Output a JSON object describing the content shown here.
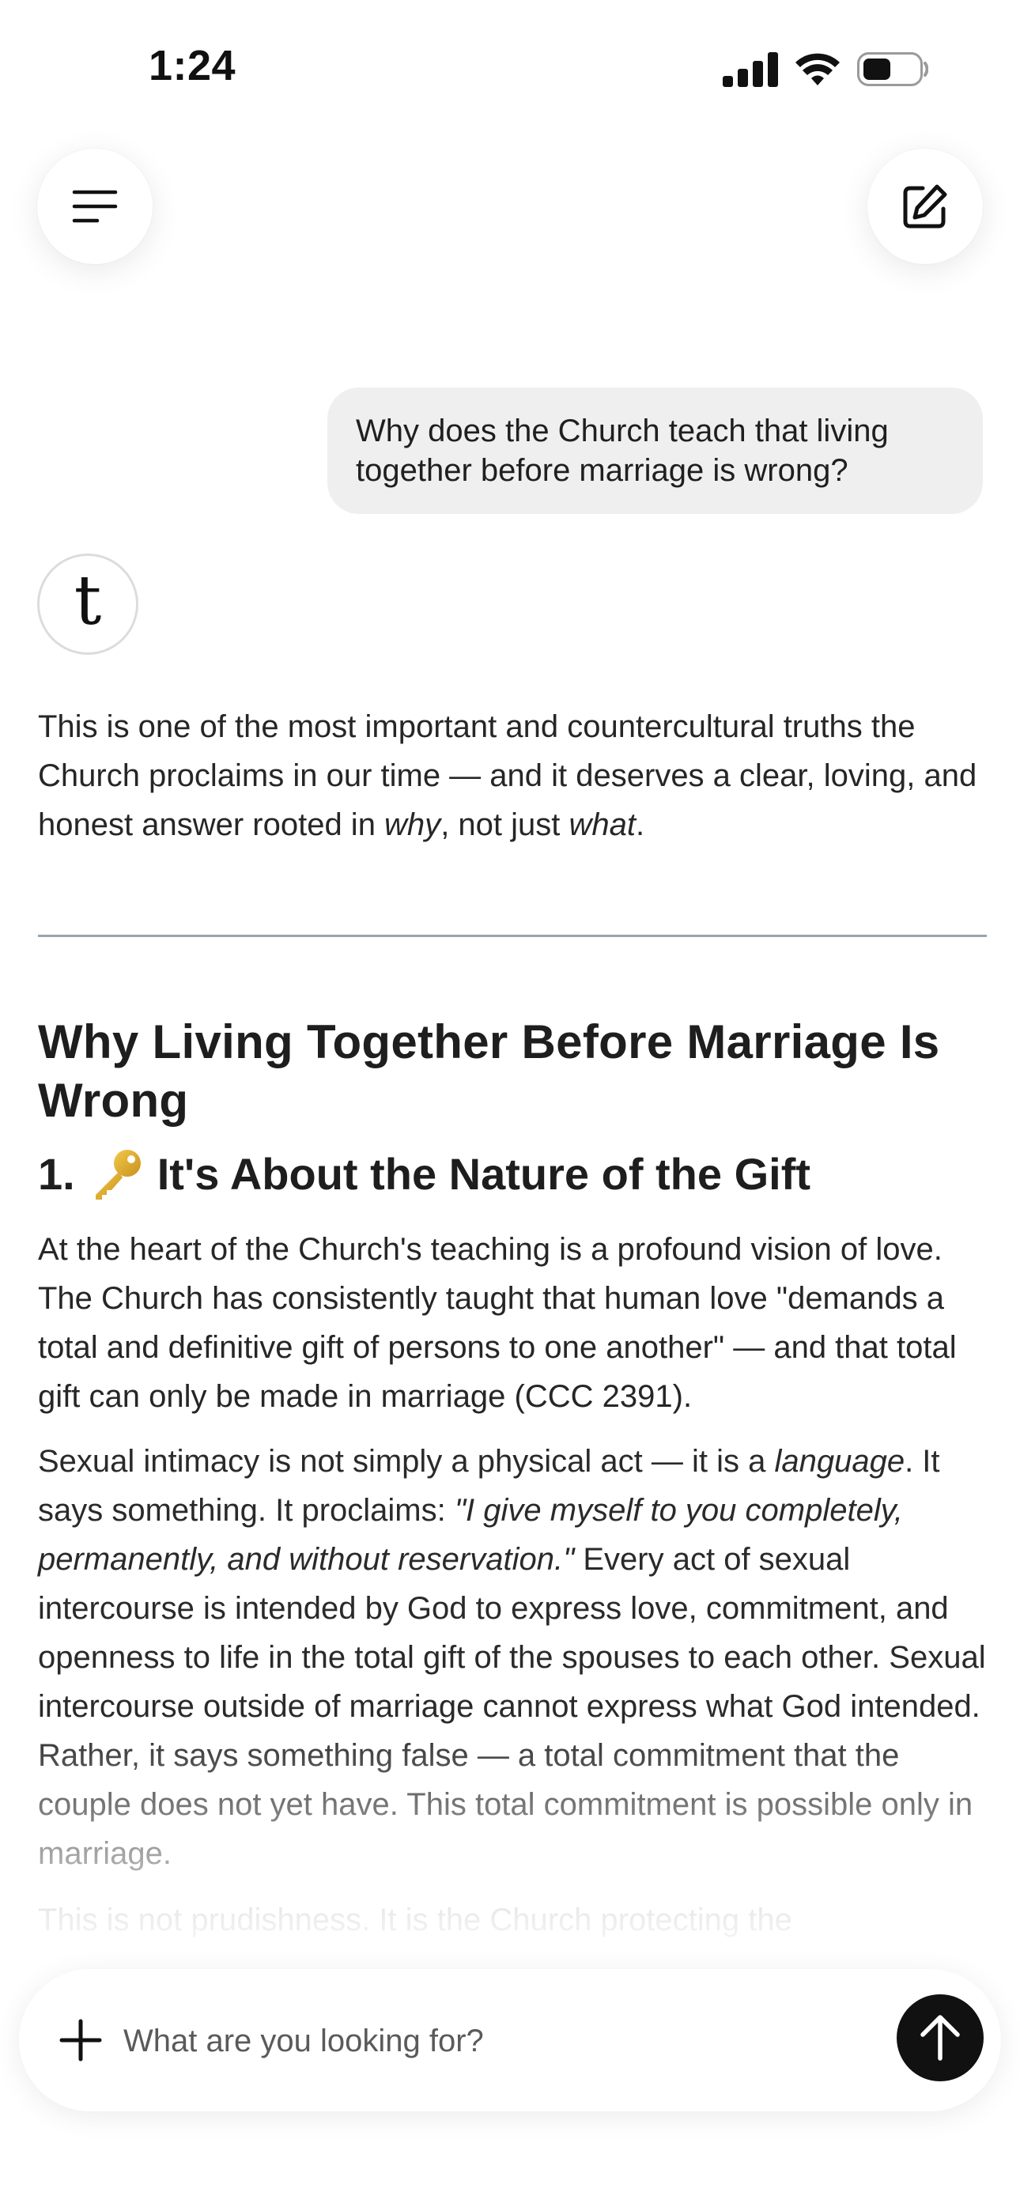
{
  "status_bar": {
    "time": "1:24"
  },
  "header": {
    "menu_icon": "hamburger-menu-icon",
    "new_chat_icon": "edit-compose-icon"
  },
  "conversation": {
    "user_message": "Why does the Church teach that living together before marriage is wrong?",
    "assistant_avatar_letter": "t",
    "intro": {
      "before_why": "This is one of the most important and countercultural truths the Church proclaims in our time — and it deserves a clear, loving, and honest answer rooted in ",
      "why": "why",
      "middle": ", not just ",
      "what": "what",
      "end": "."
    },
    "heading": "Why Living Together Before Marriage Is Wrong",
    "section_1": {
      "number": "1.",
      "icon": "key-emoji-icon",
      "title": "It's About the Nature of the Gift"
    },
    "paragraph_1": "At the heart of the Church's teaching is a profound vision of love. The Church has consistently taught that human love \"demands a total and definitive gift of persons to one another\" — and that total gift can only be made in marriage (CCC 2391).",
    "paragraph_2": {
      "part_1": "Sexual intimacy is not simply a physical act — it is a ",
      "language": "language",
      "part_2": ". It says something. It proclaims: ",
      "quote": "\"I give myself to you completely, permanently, and without reservation.\"",
      "part_3": " Every act of sexual intercourse is intended by God to express love, commitment, and openness to life in the total gift of the spouses to each other. Sexual intercourse outside of marriage cannot express what God intended. Rather, it says something false — a total commitment that the couple does not yet have. This total commitment is possible only in marriage."
    },
    "paragraph_3_partial": "This is not prudishness. It is the Church protecting the"
  },
  "composer": {
    "placeholder": "What are you looking for?",
    "add_icon": "plus-icon",
    "send_icon": "arrow-up-icon"
  }
}
